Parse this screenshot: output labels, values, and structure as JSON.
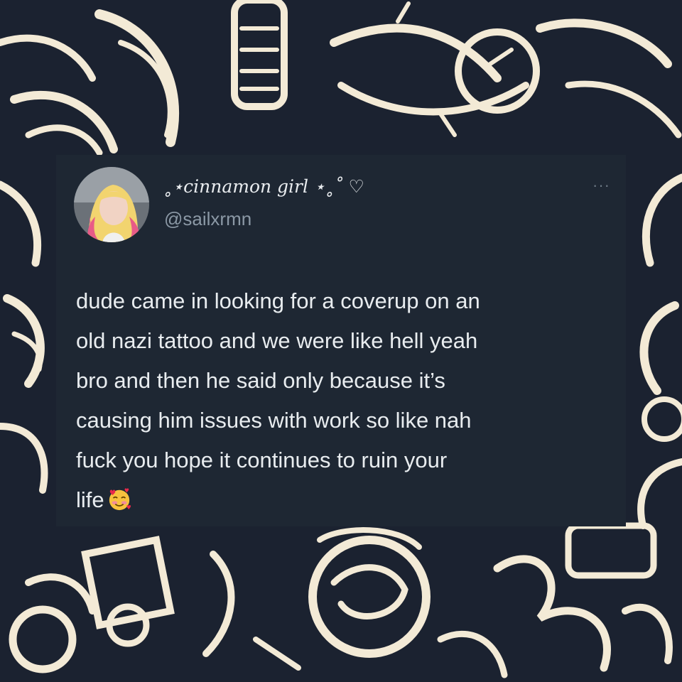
{
  "tweet": {
    "display_name": "˳⋆cinnamon girl ⋆˳˚ ♡",
    "handle": "@sailxrmn",
    "more_label": "···",
    "lines": [
      "dude came in looking for a coverup on an",
      "old nazi tattoo and we were like hell yeah",
      "bro and then he said only because it’s",
      "causing him issues with work so like nah",
      "fuck you hope it continues to ruin your",
      "life"
    ],
    "emoji": "smiling-face-with-hearts"
  },
  "colors": {
    "card_bg": "#1e2733",
    "text": "#e8ecef",
    "muted": "#8b98a5",
    "background_pattern_light": "#f3ead6",
    "background_pattern_dark": "#1b2230"
  }
}
